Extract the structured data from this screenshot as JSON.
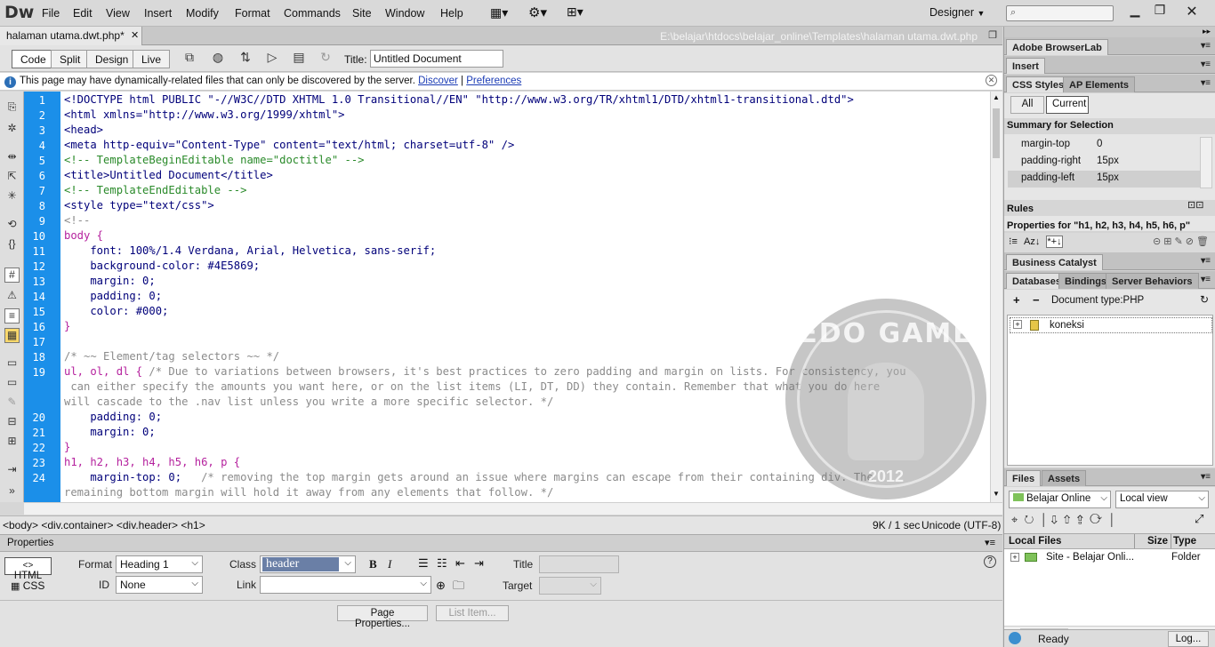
{
  "app": {
    "logo": "Dw",
    "menu": [
      "File",
      "Edit",
      "View",
      "Insert",
      "Modify",
      "Format",
      "Commands",
      "Site",
      "Window",
      "Help"
    ],
    "workspace": "Designer"
  },
  "document": {
    "tab_label": "halaman utama.dwt.php*",
    "path": "E:\\belajar\\htdocs\\belajar_online\\Templates\\halaman utama.dwt.php",
    "views": [
      "Code",
      "Split",
      "Design",
      "Live"
    ],
    "active_view": "Code",
    "title_label": "Title:",
    "title_value": "Untitled Document"
  },
  "infobar": {
    "message": "This page may have dynamically-related files that can only be discovered by the server.",
    "discover": "Discover",
    "separator": "|",
    "preferences": "Preferences"
  },
  "code_lines": [
    {
      "n": "1",
      "t": "<!DOCTYPE html PUBLIC \"-//W3C//DTD XHTML 1.0 Transitional//EN\" \"http://www.w3.org/TR/xhtml1/DTD/xhtml1-transitional.dtd\">",
      "c": "tag"
    },
    {
      "n": "2",
      "t": "<html xmlns=\"http://www.w3.org/1999/xhtml\">",
      "c": "tag"
    },
    {
      "n": "3",
      "t": "<head>",
      "c": "tag"
    },
    {
      "n": "4",
      "t": "<meta http-equiv=\"Content-Type\" content=\"text/html; charset=utf-8\" />",
      "c": "tag"
    },
    {
      "n": "5",
      "t": "<!-- TemplateBeginEditable name=\"doctitle\" -->",
      "c": "tmpl"
    },
    {
      "n": "6",
      "t": "<title>Untitled Document</title>",
      "c": "tag"
    },
    {
      "n": "7",
      "t": "<!-- TemplateEndEditable -->",
      "c": "tmpl"
    },
    {
      "n": "8",
      "t": "<style type=\"text/css\">",
      "c": "tag"
    },
    {
      "n": "9",
      "t": "<!--",
      "c": "cmt"
    },
    {
      "n": "10",
      "t": "body {",
      "c": "sel"
    },
    {
      "n": "11",
      "t": "    font: 100%/1.4 Verdana, Arial, Helvetica, sans-serif;",
      "c": "prop"
    },
    {
      "n": "12",
      "t": "    background-color: #4E5869;",
      "c": "prop"
    },
    {
      "n": "13",
      "t": "    margin: 0;",
      "c": "prop"
    },
    {
      "n": "14",
      "t": "    padding: 0;",
      "c": "prop"
    },
    {
      "n": "15",
      "t": "    color: #000;",
      "c": "prop"
    },
    {
      "n": "16",
      "t": "}",
      "c": "sel"
    },
    {
      "n": "17",
      "t": "",
      "c": "ctext"
    },
    {
      "n": "18",
      "t": "/* ~~ Element/tag selectors ~~ */",
      "c": "cmt"
    },
    {
      "n": "19",
      "t": "ul, ol, dl { /* Due to variations between browsers, it's best practices to zero padding and margin on lists. For consistency, you",
      "c": "mixsel"
    },
    {
      "n": "",
      "t": " can either specify the amounts you want here, or on the list items (LI, DT, DD) they contain. Remember that what you do here",
      "c": "cmt"
    },
    {
      "n": "",
      "t": "will cascade to the .nav list unless you write a more specific selector. */",
      "c": "cmt"
    },
    {
      "n": "20",
      "t": "    padding: 0;",
      "c": "prop"
    },
    {
      "n": "21",
      "t": "    margin: 0;",
      "c": "prop"
    },
    {
      "n": "22",
      "t": "}",
      "c": "sel"
    },
    {
      "n": "23",
      "t": "h1, h2, h3, h4, h5, h6, p {",
      "c": "sel"
    },
    {
      "n": "24",
      "t": "    margin-top: 0;   /* removing the top margin gets around an issue where margins can escape from their containing div. The",
      "c": "mixprop"
    },
    {
      "n": "",
      "t": "remaining bottom margin will hold it away from any elements that follow. */",
      "c": "cmt"
    }
  ],
  "status": {
    "tags": "<body> <div.container> <div.header> <h1>",
    "size": "9K / 1 sec",
    "encoding": "Unicode (UTF-8)"
  },
  "properties": {
    "header": "Properties",
    "html_btn": "HTML",
    "css_btn": "CSS",
    "format_label": "Format",
    "format_value": "Heading 1",
    "id_label": "ID",
    "id_value": "None",
    "class_label": "Class",
    "class_value": "header",
    "link_label": "Link",
    "title_label": "Title",
    "target_label": "Target",
    "page_props": "Page Properties...",
    "list_item": "List Item..."
  },
  "panels": {
    "browserlab": "Adobe BrowserLab",
    "insert": "Insert",
    "css_tab": "CSS Styles",
    "ap_tab": "AP Elements",
    "all_btn": "All",
    "current_btn": "Current",
    "summary": "Summary for Selection",
    "summary_rows": [
      {
        "prop": "margin-top",
        "val": "0"
      },
      {
        "prop": "padding-right",
        "val": "15px"
      },
      {
        "prop": "padding-left",
        "val": "15px"
      }
    ],
    "rules": "Rules",
    "properties_for": "Properties for \"h1, h2, h3, h4, h5, h6, p\"",
    "business_catalyst": "Business Catalyst",
    "db_tab": "Databases",
    "bindings_tab": "Bindings",
    "server_tab": "Server Behaviors",
    "doc_type": "Document type:PHP",
    "connection": "koneksi",
    "files_tab": "Files",
    "assets_tab": "Assets",
    "site_select": "Belajar Online",
    "view_select": "Local view",
    "local_files": "Local Files",
    "size_col": "Size",
    "type_col": "Type",
    "site_row": "Site - Belajar Onli...",
    "site_type": "Folder",
    "ready": "Ready",
    "log_btn": "Log..."
  },
  "watermark": {
    "label": "EDO GAME",
    "year": "2012"
  },
  "colors": {
    "gutter": "#1b8fe9",
    "tag": "#00007a",
    "selector": "#b5229e",
    "comment": "#8b8b8b",
    "template": "#2a8a2a"
  }
}
